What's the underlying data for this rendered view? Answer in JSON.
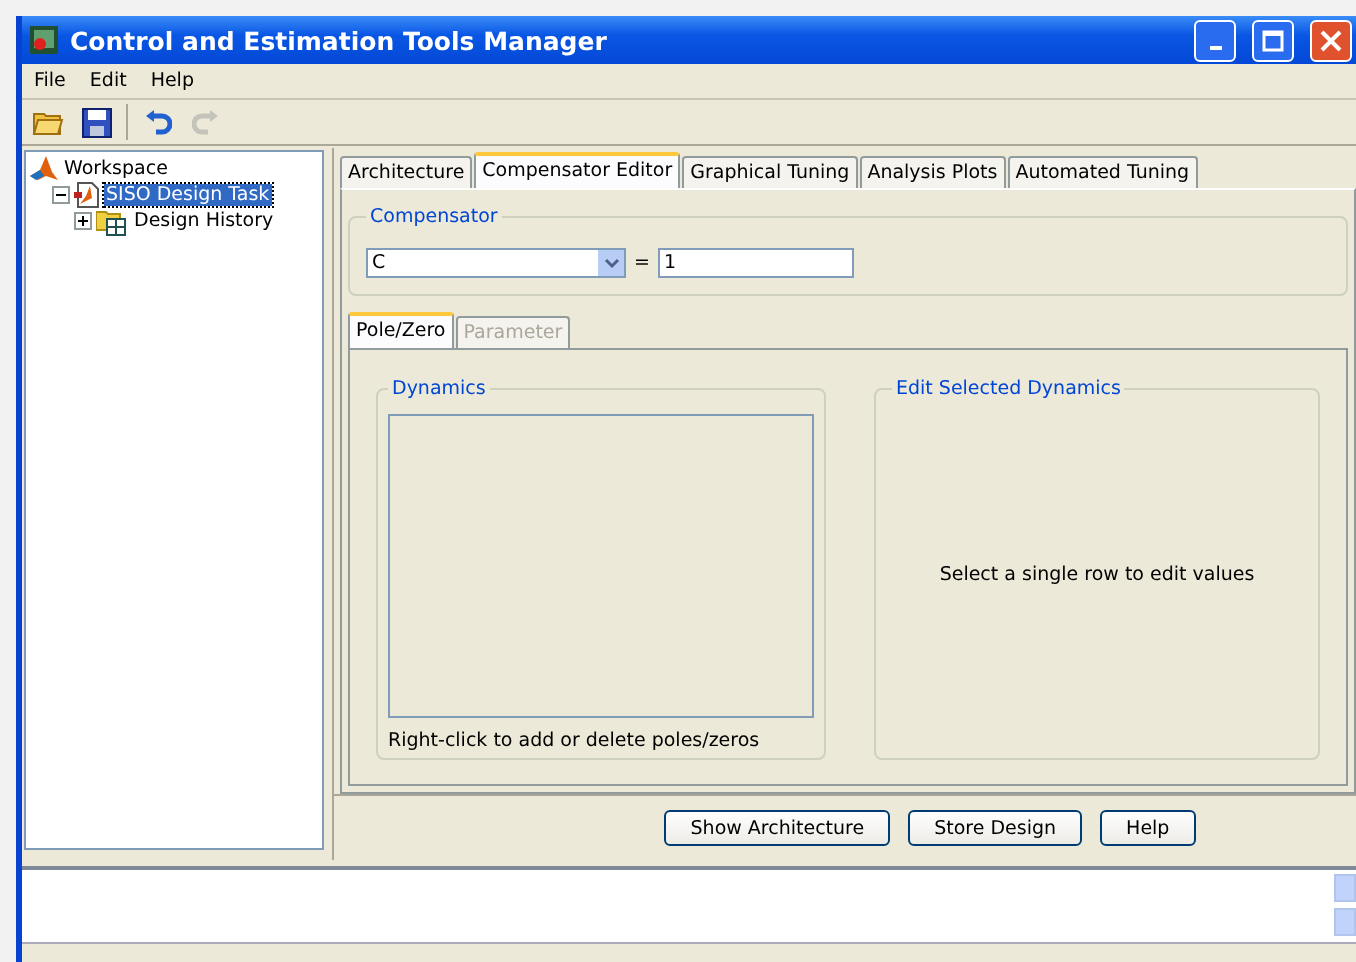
{
  "window": {
    "title": "Control and Estimation Tools Manager"
  },
  "menu": [
    "File",
    "Edit",
    "Help"
  ],
  "toolbar": [
    {
      "kind": "open",
      "disabled": false
    },
    {
      "kind": "save",
      "disabled": false
    },
    {
      "kind": "undo",
      "disabled": false
    },
    {
      "kind": "redo",
      "disabled": true
    }
  ],
  "tree": [
    {
      "label": "Workspace",
      "kind": "workspace",
      "selected": false,
      "children": [
        {
          "label": "SISO Design Task",
          "kind": "task",
          "selected": true,
          "expanded": true,
          "children": [
            {
              "label": "Design History",
              "kind": "history",
              "selected": false,
              "expanded": false
            }
          ]
        }
      ]
    }
  ],
  "tabs": [
    {
      "label": "Architecture",
      "selected": false
    },
    {
      "label": "Compensator Editor",
      "selected": true
    },
    {
      "label": "Graphical Tuning",
      "selected": false
    },
    {
      "label": "Analysis Plots",
      "selected": false
    },
    {
      "label": "Automated Tuning",
      "selected": false
    }
  ],
  "compensator": {
    "title": "Compensator",
    "name": "C",
    "equals": "=",
    "value": "1"
  },
  "subtabs": [
    {
      "label": "Pole/Zero",
      "selected": true,
      "disabled": false
    },
    {
      "label": "Parameter",
      "selected": false,
      "disabled": true
    }
  ],
  "dynamics": {
    "title": "Dynamics",
    "hint": "Right-click to add or delete poles/zeros"
  },
  "edit_selected": {
    "title": "Edit Selected Dynamics",
    "message": "Select a single row to edit values"
  },
  "buttons": [
    "Show Architecture",
    "Store Design",
    "Help"
  ]
}
